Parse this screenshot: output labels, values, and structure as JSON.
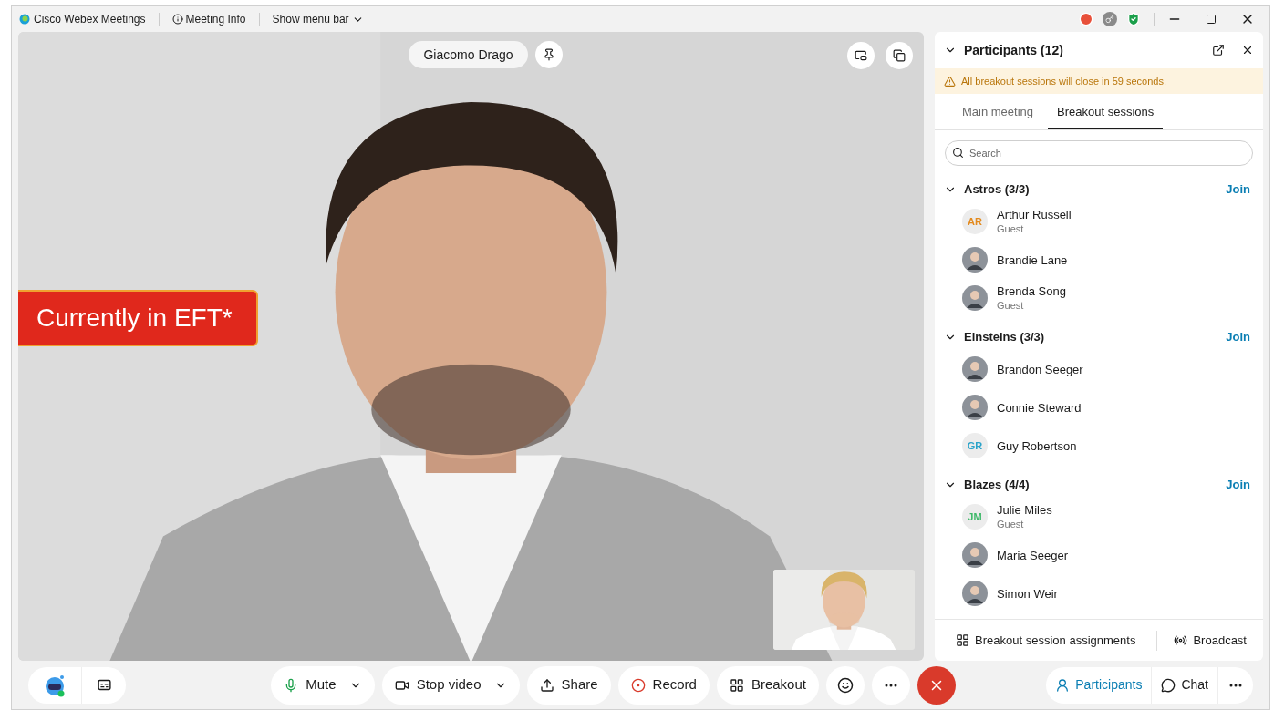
{
  "window": {
    "title": "Cisco Webex Meetings",
    "menu": [
      {
        "label": "Meeting Info",
        "kind": "info"
      },
      {
        "label": "Show menu bar",
        "kind": "dropdown"
      }
    ]
  },
  "video": {
    "speaker_name": "Giacomo Drago",
    "overlay_label": "Currently in EFT*"
  },
  "panel": {
    "title": "Participants (12)",
    "expanded": true,
    "warning": "All breakout sessions will close in 59 seconds.",
    "tabs": [
      {
        "label": "Main meeting",
        "selected": false
      },
      {
        "label": "Breakout sessions",
        "selected": true
      }
    ],
    "search": {
      "placeholder": "Search"
    },
    "sessions": [
      {
        "name": "Astros (3/3)",
        "expanded": true,
        "action": "Join",
        "members": [
          {
            "name": "Arthur Russell",
            "subtitle": "Guest",
            "kind": "initials",
            "initials": "AR",
            "color": "#e38a1e"
          },
          {
            "name": "Brandie Lane"
          },
          {
            "name": "Brenda Song",
            "subtitle": "Guest"
          }
        ]
      },
      {
        "name": "Einsteins (3/3)",
        "expanded": true,
        "action": "Join",
        "members": [
          {
            "name": "Brandon Seeger"
          },
          {
            "name": "Connie Steward"
          },
          {
            "name": "Guy Robertson",
            "kind": "initials",
            "initials": "GR",
            "color": "#2aa3c9"
          }
        ]
      },
      {
        "name": "Blazes (4/4)",
        "expanded": true,
        "action": "Join",
        "members": [
          {
            "name": "Julie Miles",
            "subtitle": "Guest",
            "kind": "initials",
            "initials": "JM",
            "color": "#3fb96a"
          },
          {
            "name": "Maria Seeger"
          },
          {
            "name": "Simon Weir"
          }
        ]
      }
    ],
    "footer": [
      {
        "label": "Breakout session assignments",
        "kind": "assignments"
      },
      {
        "label": "Broadcast",
        "kind": "broadcast"
      }
    ]
  },
  "toolbar": {
    "center": [
      {
        "label": "Mute",
        "kind": "mute",
        "dropdown": true
      },
      {
        "label": "Stop video",
        "kind": "video",
        "dropdown": true
      },
      {
        "label": "Share",
        "kind": "share",
        "dropdown": false
      },
      {
        "label": "Record",
        "kind": "record",
        "dropdown": false
      },
      {
        "label": "Breakout",
        "kind": "breakout",
        "dropdown": false
      }
    ],
    "right": [
      {
        "label": "Participants",
        "kind": "participants",
        "selected": true
      },
      {
        "label": "Chat",
        "kind": "chat",
        "selected": false
      }
    ]
  }
}
